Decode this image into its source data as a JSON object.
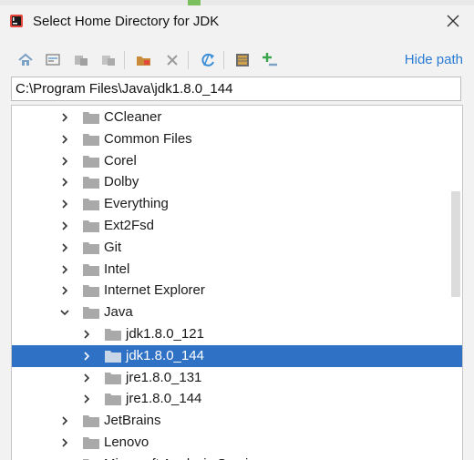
{
  "dialog": {
    "title": "Select Home Directory for JDK"
  },
  "toolbar": {
    "buttons": [
      {
        "name": "home-icon"
      },
      {
        "name": "desktop-icon"
      },
      {
        "name": "project-icon"
      },
      {
        "name": "module-icon"
      },
      {
        "name": "new-folder-icon"
      },
      {
        "name": "delete-icon"
      },
      {
        "name": "refresh-icon"
      },
      {
        "name": "show-hidden-icon"
      },
      {
        "name": "add-icon"
      }
    ],
    "hide_path_label": "Hide path"
  },
  "path": {
    "value": "C:\\Program Files\\Java\\jdk1.8.0_144"
  },
  "tree": {
    "items": [
      {
        "label": "CCleaner",
        "depth": 0,
        "expanded": false
      },
      {
        "label": "Common Files",
        "depth": 0,
        "expanded": false
      },
      {
        "label": "Corel",
        "depth": 0,
        "expanded": false
      },
      {
        "label": "Dolby",
        "depth": 0,
        "expanded": false
      },
      {
        "label": "Everything",
        "depth": 0,
        "expanded": false
      },
      {
        "label": "Ext2Fsd",
        "depth": 0,
        "expanded": false
      },
      {
        "label": "Git",
        "depth": 0,
        "expanded": false
      },
      {
        "label": "Intel",
        "depth": 0,
        "expanded": false
      },
      {
        "label": "Internet Explorer",
        "depth": 0,
        "expanded": false
      },
      {
        "label": "Java",
        "depth": 0,
        "expanded": true
      },
      {
        "label": "jdk1.8.0_121",
        "depth": 1,
        "expanded": false
      },
      {
        "label": "jdk1.8.0_144",
        "depth": 1,
        "expanded": false,
        "selected": true
      },
      {
        "label": "jre1.8.0_131",
        "depth": 1,
        "expanded": false
      },
      {
        "label": "jre1.8.0_144",
        "depth": 1,
        "expanded": false
      },
      {
        "label": "JetBrains",
        "depth": 0,
        "expanded": false
      },
      {
        "label": "Lenovo",
        "depth": 0,
        "expanded": false
      },
      {
        "label": "Microsoft Analysis Services",
        "depth": 0,
        "expanded": false
      }
    ]
  },
  "colors": {
    "selection": "#2f71c5",
    "link": "#2a7bd4"
  }
}
